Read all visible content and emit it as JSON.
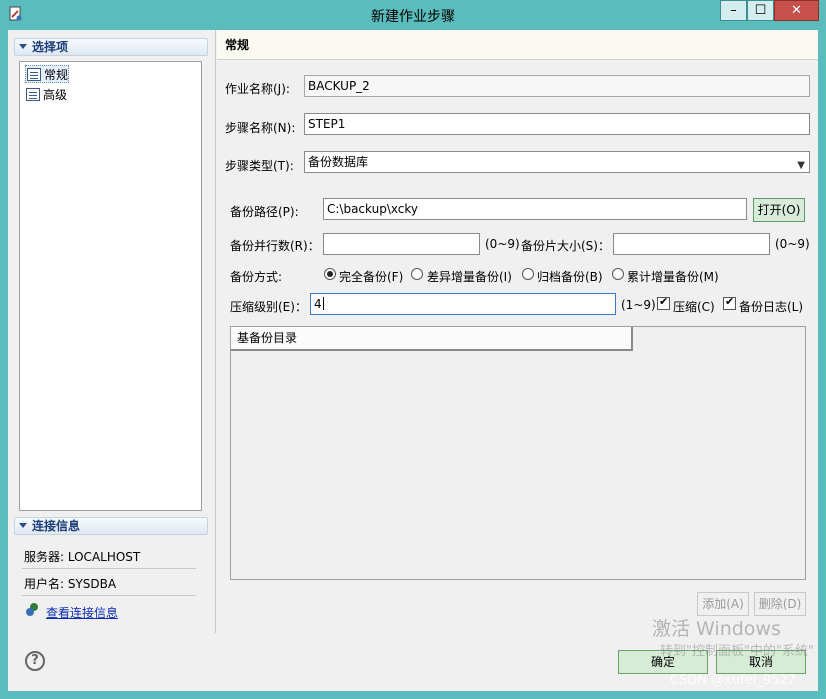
{
  "window": {
    "title": "新建作业步骤",
    "minimize": "–",
    "maximize": "☐",
    "close": "✕"
  },
  "sidebar": {
    "select_header": "选择项",
    "items": [
      {
        "label": "常规"
      },
      {
        "label": "高级"
      }
    ],
    "connection_header": "连接信息",
    "server": "服务器: LOCALHOST",
    "user": "用户名: SYSDBA",
    "view_link": "查看连接信息"
  },
  "page": {
    "title": "常规",
    "job_name_label": "作业名称(J):",
    "job_name": "BACKUP_2",
    "step_name_label": "步骤名称(N):",
    "step_name": "STEP1",
    "step_type_label": "步骤类型(T):",
    "step_type": "备份数据库",
    "backup_path_label": "备份路径(P):",
    "backup_path": "C:\\backup\\xcky",
    "open_button": "打开(O)",
    "parallel_label": "备份并行数(R)：",
    "parallel_value": "",
    "parallel_range": "(0~9)",
    "piece_size_label": "备份片大小(S)：",
    "piece_size_value": "",
    "piece_size_range": "(0~9)",
    "mode_label": "备份方式:",
    "modes": [
      {
        "label": "完全备份(F)",
        "selected": true
      },
      {
        "label": "差异增量备份(I)",
        "selected": false
      },
      {
        "label": "归档备份(B)",
        "selected": false
      },
      {
        "label": "累计增量备份(M)",
        "selected": false
      }
    ],
    "compress_level_label": "压缩级别(E)：",
    "compress_level": "4",
    "compress_range": "(1~9)",
    "compress_label": "压缩(C)",
    "compress_checked": true,
    "log_label": "备份日志(L)",
    "log_checked": true,
    "base_dir_header": "基备份目录",
    "add_button": "添加(A)",
    "delete_button": "删除(D)"
  },
  "footer": {
    "ok": "确定",
    "cancel": "取消"
  },
  "overlay": {
    "activate_title": "激活 Windows",
    "activate_sub": "转到\"控制面板\"中的\"系统\"",
    "credit": "CSDN @xufei_9527"
  },
  "colors": {
    "titlebar": "#5bbcbe",
    "close": "#c7504b",
    "link": "#0b2bb3"
  }
}
